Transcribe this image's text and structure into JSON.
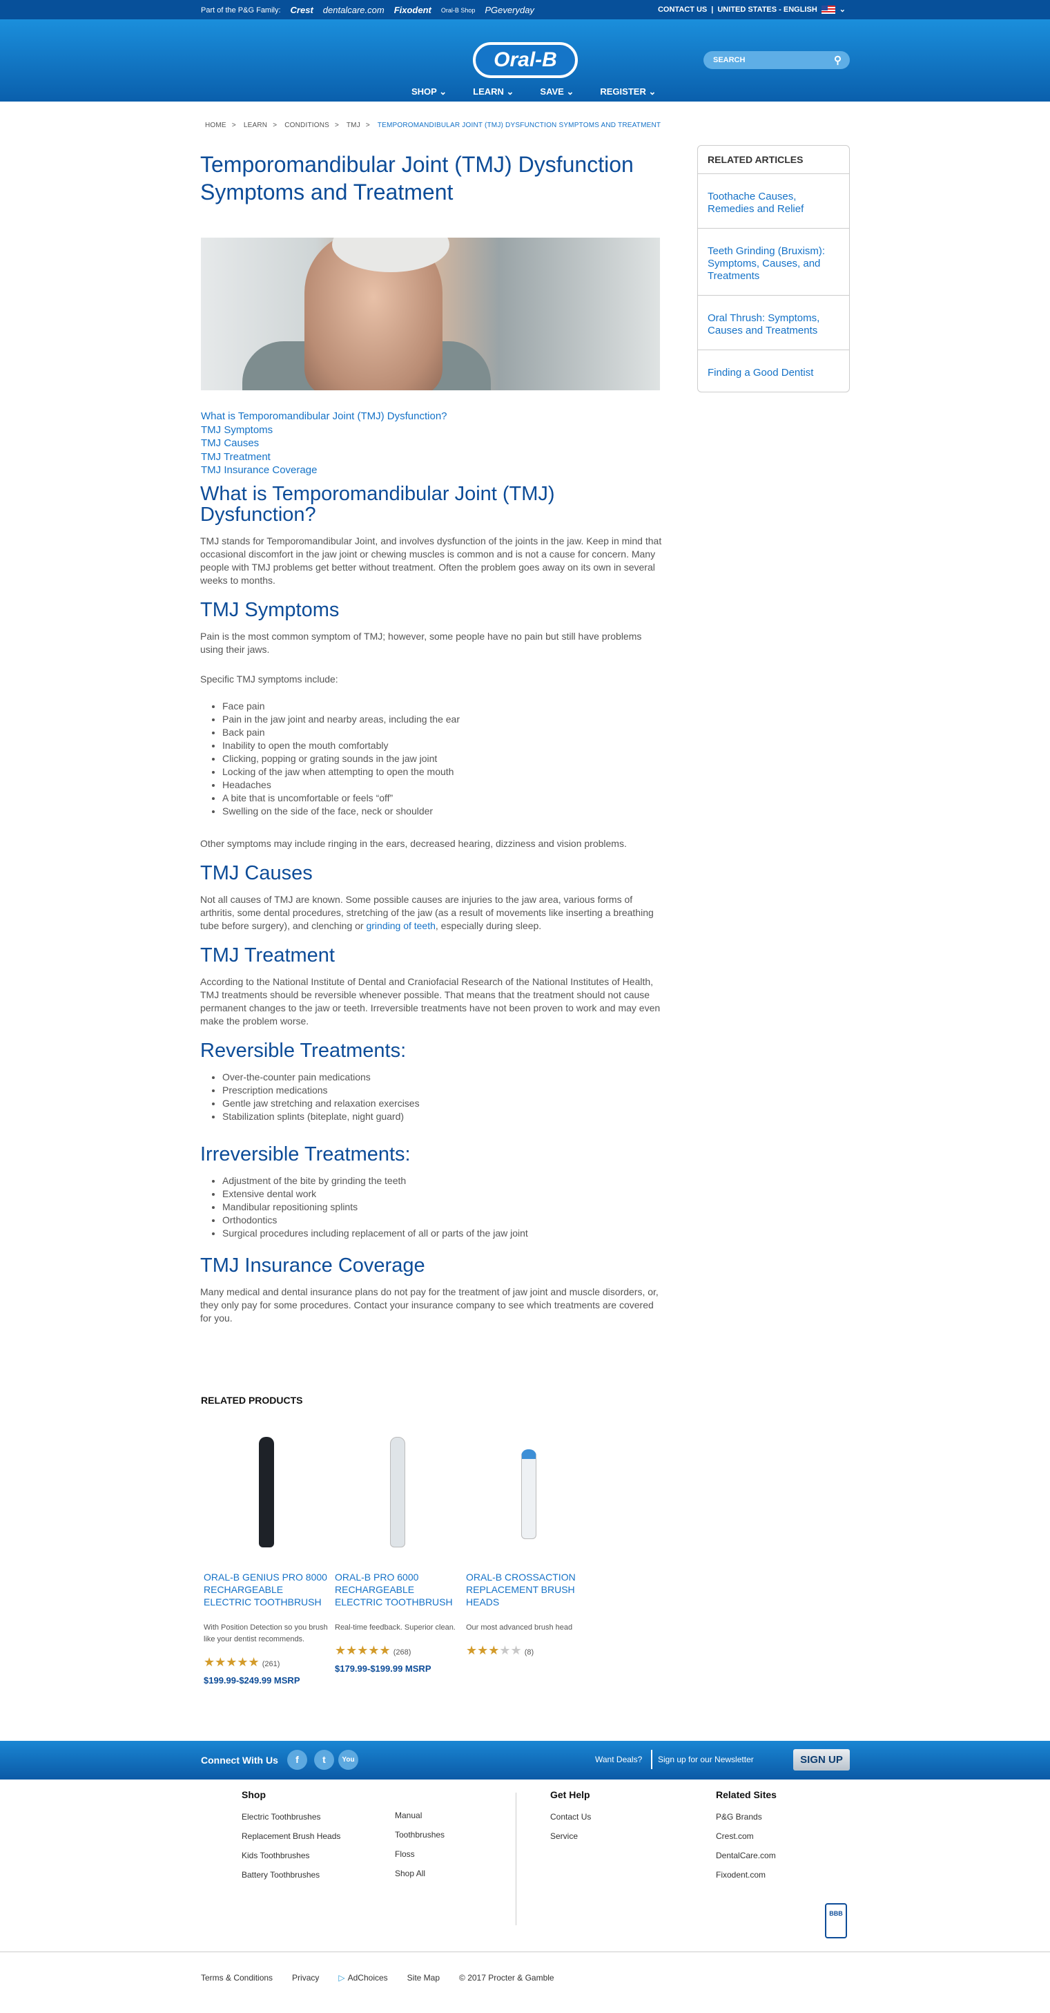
{
  "topbar": {
    "family_label": "Part of the P&G Family:",
    "brands": [
      "Crest",
      "dentalcare.com",
      "Fixodent",
      "Oral-B Shop",
      "PGeveryday"
    ],
    "contact": "CONTACT US",
    "region": "UNITED STATES - ENGLISH"
  },
  "header": {
    "logo": "Oral-B",
    "search_placeholder": "SEARCH",
    "nav": [
      "SHOP",
      "LEARN",
      "SAVE",
      "REGISTER"
    ]
  },
  "breadcrumb": [
    "HOME",
    "LEARN",
    "CONDITIONS",
    "TMJ",
    "TEMPOROMANDIBULAR JOINT (TMJ) DYSFUNCTION SYMPTOMS AND TREATMENT"
  ],
  "article": {
    "title": "Temporomandibular Joint (TMJ) Dysfunction Symptoms and Treatment",
    "toc": [
      "What is Temporomandibular Joint (TMJ) Dysfunction?",
      "TMJ Symptoms",
      "TMJ Causes",
      "TMJ Treatment",
      "TMJ Insurance Coverage"
    ],
    "what_heading": "What is Temporomandibular Joint (TMJ) Dysfunction?",
    "what_p": "TMJ stands for Temporomandibular Joint, and involves dysfunction of the joints in the jaw. Keep in mind that occasional discomfort in the jaw joint or chewing muscles is common and is not a cause for concern. Many people with TMJ problems get better without treatment. Often the problem goes away on its own in several weeks to months.",
    "symptoms_heading": "TMJ Symptoms",
    "symptoms_p1": "Pain is the most common symptom of TMJ; however, some people have no pain but still have problems using their jaws.",
    "symptoms_p2": "Specific TMJ symptoms include:",
    "symptoms_list": [
      "Face pain",
      "Pain in the jaw joint and nearby areas, including the ear",
      "Back pain",
      "Inability to open the mouth comfortably",
      "Clicking, popping or grating sounds in the jaw joint",
      "Locking of the jaw when attempting to open the mouth",
      "Headaches",
      "A bite that is uncomfortable or feels “off”",
      "Swelling on the side of the face, neck or shoulder"
    ],
    "symptoms_p3": "Other symptoms may include ringing in the ears, decreased hearing, dizziness and vision problems.",
    "causes_heading": "TMJ Causes",
    "causes_p_before": "Not all causes of TMJ are known. Some possible causes are injuries to the jaw area, various forms of arthritis, some dental procedures, stretching of the jaw (as a result of movements like inserting a breathing tube before surgery), and clenching or ",
    "causes_link": "grinding of teeth",
    "causes_p_after": ", especially during sleep.",
    "treatment_heading": "TMJ Treatment",
    "treatment_p": "According to the National Institute of Dental and Craniofacial Research of the National Institutes of Health, TMJ treatments should be reversible whenever possible. That means that the treatment should not cause permanent changes to the jaw or teeth. Irreversible treatments have not been proven to work and may even make the problem worse.",
    "reversible_heading": "Reversible Treatments:",
    "reversible_list": [
      "Over-the-counter pain medications",
      "Prescription medications",
      "Gentle jaw stretching and relaxation exercises",
      "Stabilization splints (biteplate, night guard)"
    ],
    "irreversible_heading": "Irreversible Treatments:",
    "irreversible_list": [
      "Adjustment of the bite by grinding the teeth",
      "Extensive dental work",
      "Mandibular repositioning splints",
      "Orthodontics",
      "Surgical procedures including replacement of all or parts of the jaw joint"
    ],
    "insurance_heading": "TMJ Insurance Coverage",
    "insurance_p": "Many medical and dental insurance plans do not pay for the treatment of jaw joint and muscle disorders, or, they only pay for some procedures. Contact your insurance company to see which treatments are covered for you."
  },
  "sidebar": {
    "heading": "RELATED ARTICLES",
    "items": [
      "Toothache Causes, Remedies and Relief",
      "Teeth Grinding (Bruxism): Symptoms, Causes, and Treatments",
      "Oral Thrush: Symptoms, Causes and Treatments",
      "Finding a Good Dentist"
    ]
  },
  "related_products": {
    "heading": "RELATED PRODUCTS",
    "items": [
      {
        "name": "ORAL-B GENIUS PRO 8000 RECHARGEABLE ELECTRIC TOOTHBRUSH",
        "desc": "With Position Detection so you brush like your dentist recommends.",
        "rating": 5,
        "reviews": "(261)",
        "price": "$199.99-$249.99 MSRP",
        "color": "#1e2228"
      },
      {
        "name": "ORAL-B PRO 6000 RECHARGEABLE ELECTRIC TOOTHBRUSH",
        "desc": "Real-time feedback. Superior clean.",
        "rating": 5,
        "reviews": "(268)",
        "price": "$179.99-$199.99 MSRP",
        "color": "#e8ecef"
      },
      {
        "name": "ORAL-B CROSSACTION REPLACEMENT BRUSH HEADS",
        "desc": "Our most advanced brush head",
        "rating": 3.5,
        "reviews": "(8)",
        "price": "",
        "color": "#f4f6f8"
      }
    ]
  },
  "connect": {
    "label": "Connect With Us",
    "social": [
      "f",
      "t",
      "You"
    ],
    "deals": "Want Deals?",
    "newsletter": "Sign up for our Newsletter",
    "signup": "SIGN UP"
  },
  "footer": {
    "shop_heading": "Shop",
    "shop_col1": [
      "Electric Toothbrushes",
      "Replacement Brush Heads",
      "Kids Toothbrushes",
      "Battery Toothbrushes"
    ],
    "shop_col2": [
      "Manual",
      "Toothbrushes",
      "Floss",
      "Shop All"
    ],
    "help_heading": "Get Help",
    "help_links": [
      "Contact Us",
      "Service"
    ],
    "sites_heading": "Related Sites",
    "sites_links": [
      "P&G Brands",
      "Crest.com",
      "DentalCare.com",
      "Fixodent.com"
    ],
    "bbb": "BBB",
    "legal": [
      "Terms & Conditions",
      "Privacy",
      "AdChoices",
      "Site Map",
      "© 2017 Procter & Gamble"
    ]
  },
  "colors": {
    "brand_blue": "#0d4c98",
    "link": "#1572c7",
    "star": "#d39b2a"
  }
}
